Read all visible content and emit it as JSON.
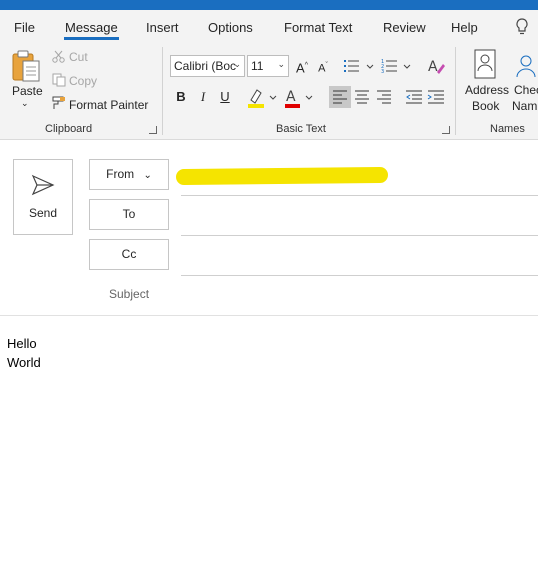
{
  "tabs": [
    "File",
    "Message",
    "Insert",
    "Options",
    "Format Text",
    "Review",
    "Help"
  ],
  "ribbon": {
    "clipboard": {
      "paste": "Paste",
      "cut": "Cut",
      "copy": "Copy",
      "format_painter": "Format Painter",
      "label": "Clipboard"
    },
    "basic_text": {
      "font_name": "Calibri (Boc",
      "font_size": "11",
      "bold": "B",
      "italic": "I",
      "underline": "U",
      "font_color": "A",
      "label": "Basic Text"
    },
    "names": {
      "address_book_line1": "Address",
      "address_book_line2": "Book",
      "check_names_line1": "Chec",
      "check_names_line2": "Nam",
      "label": "Names"
    }
  },
  "compose": {
    "send": "Send",
    "from": "From",
    "to": "To",
    "cc": "Cc",
    "subject": "Subject"
  },
  "body": [
    "Hello",
    "World"
  ],
  "colors": {
    "accent": "#1a6ec0",
    "highlight": "#f5e400",
    "font_color_bar": "#e00000"
  }
}
